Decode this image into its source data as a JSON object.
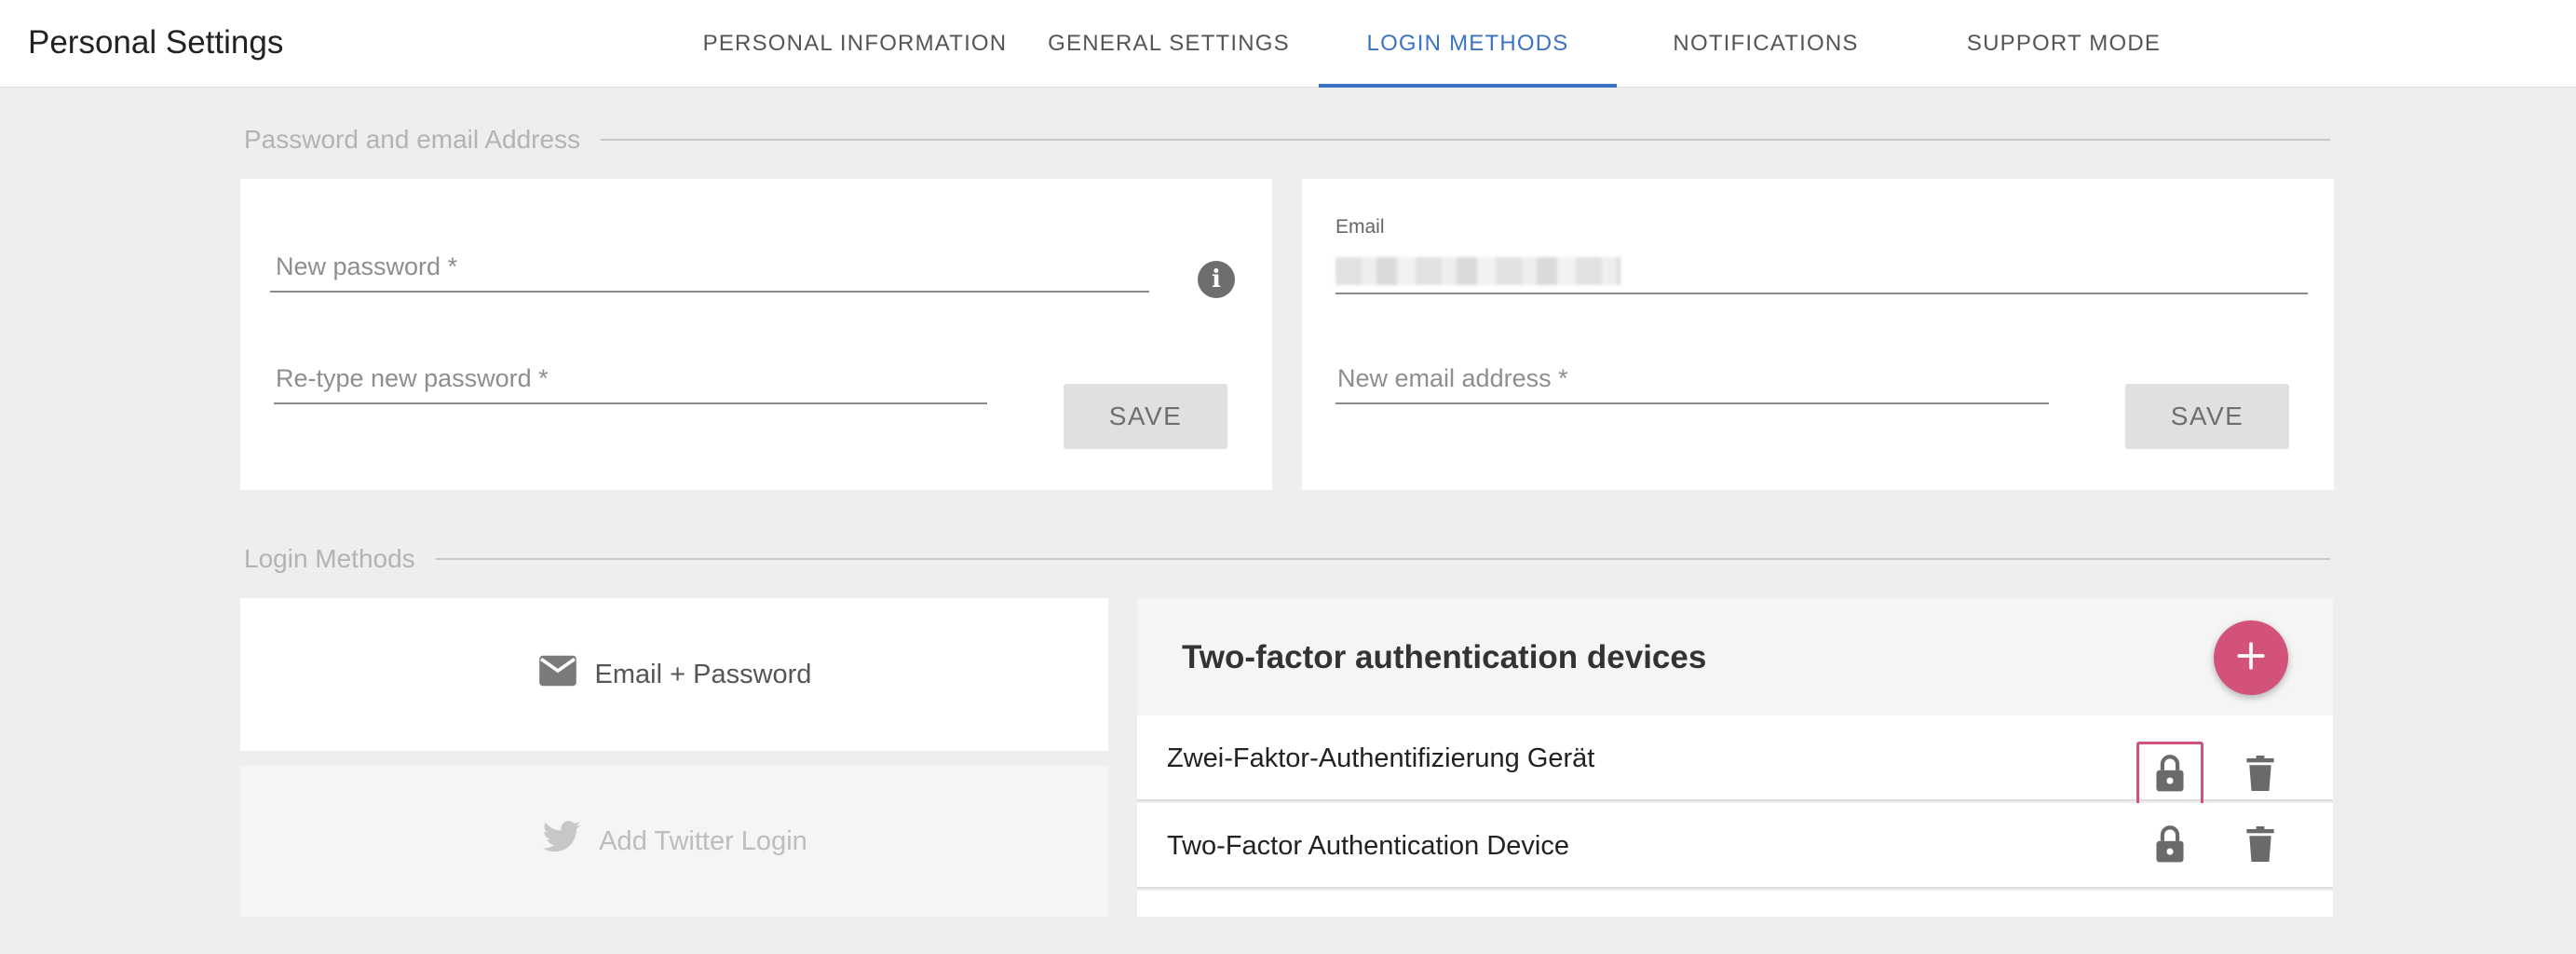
{
  "header": {
    "title": "Personal Settings",
    "tabs": [
      {
        "label": "PERSONAL INFORMATION"
      },
      {
        "label": "GENERAL SETTINGS"
      },
      {
        "label": "LOGIN METHODS"
      },
      {
        "label": "NOTIFICATIONS"
      },
      {
        "label": "SUPPORT MODE"
      }
    ],
    "active_tab": "LOGIN METHODS",
    "accent_color": "#3b73c3"
  },
  "password_section": {
    "heading": "Password and email Address",
    "new_password_placeholder": "New password *",
    "retype_password_placeholder": "Re-type new password *",
    "save_label": "SAVE",
    "info_icon": "info-icon"
  },
  "email_section": {
    "email_label": "Email",
    "new_email_placeholder": "New email address *",
    "save_label": "SAVE"
  },
  "login_methods": {
    "heading": "Login Methods",
    "methods": [
      {
        "label": "Email + Password",
        "icon": "mail-icon"
      },
      {
        "label": "Add Twitter Login",
        "icon": "twitter-icon",
        "disabled": true
      }
    ]
  },
  "two_factor": {
    "title": "Two-factor authentication devices",
    "add_icon": "plus-icon",
    "fab_color": "#d2527a",
    "devices": [
      {
        "name": "Zwei-Faktor-Authentifizierung Gerät"
      },
      {
        "name": "Two-Factor Authentication Device"
      }
    ]
  }
}
